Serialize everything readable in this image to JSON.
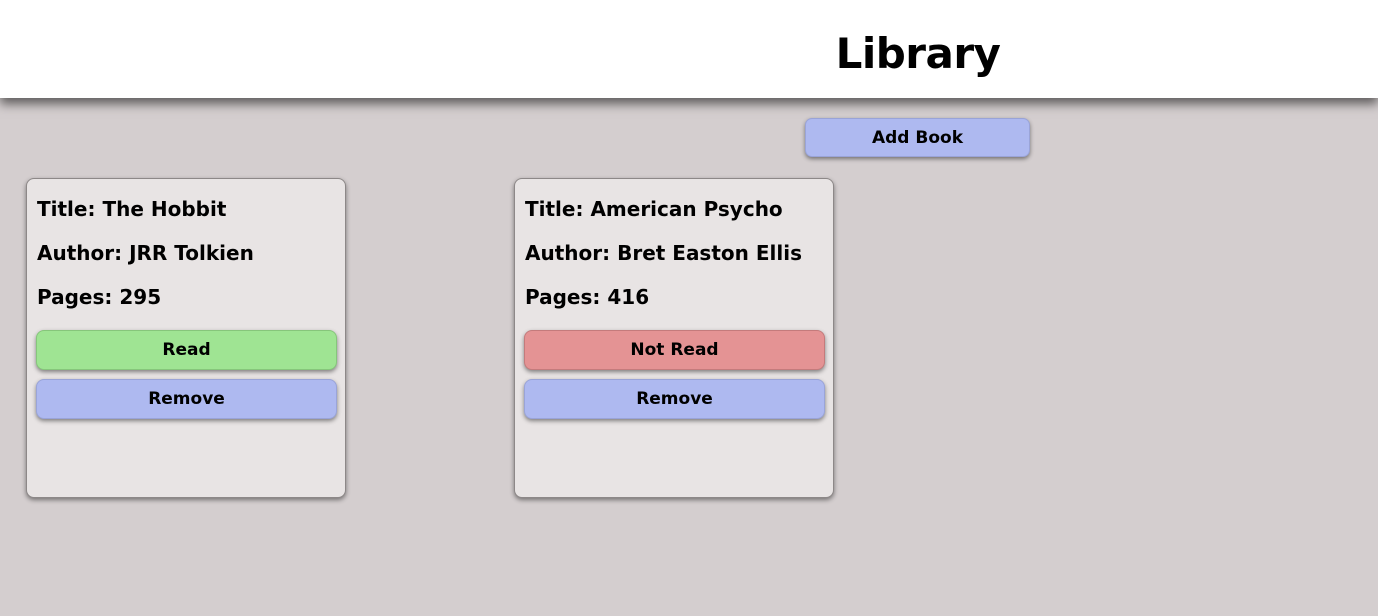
{
  "header": {
    "title": "Library"
  },
  "toolbar": {
    "add_book_label": "Add Book"
  },
  "books": [
    {
      "title_text": "Title: The Hobbit",
      "author_text": "Author: JRR Tolkien",
      "pages_text": "Pages: 295",
      "status_label": "Read",
      "status_color": "#9fe493",
      "remove_label": "Remove"
    },
    {
      "title_text": "Title: American Psycho",
      "author_text": "Author: Bret Easton Ellis",
      "pages_text": "Pages: 416",
      "status_label": "Not Read",
      "status_color": "#e49394",
      "remove_label": "Remove"
    }
  ],
  "colors": {
    "background": "#d4cecf",
    "card": "#e8e4e4",
    "button_primary": "#aeb9f0"
  }
}
